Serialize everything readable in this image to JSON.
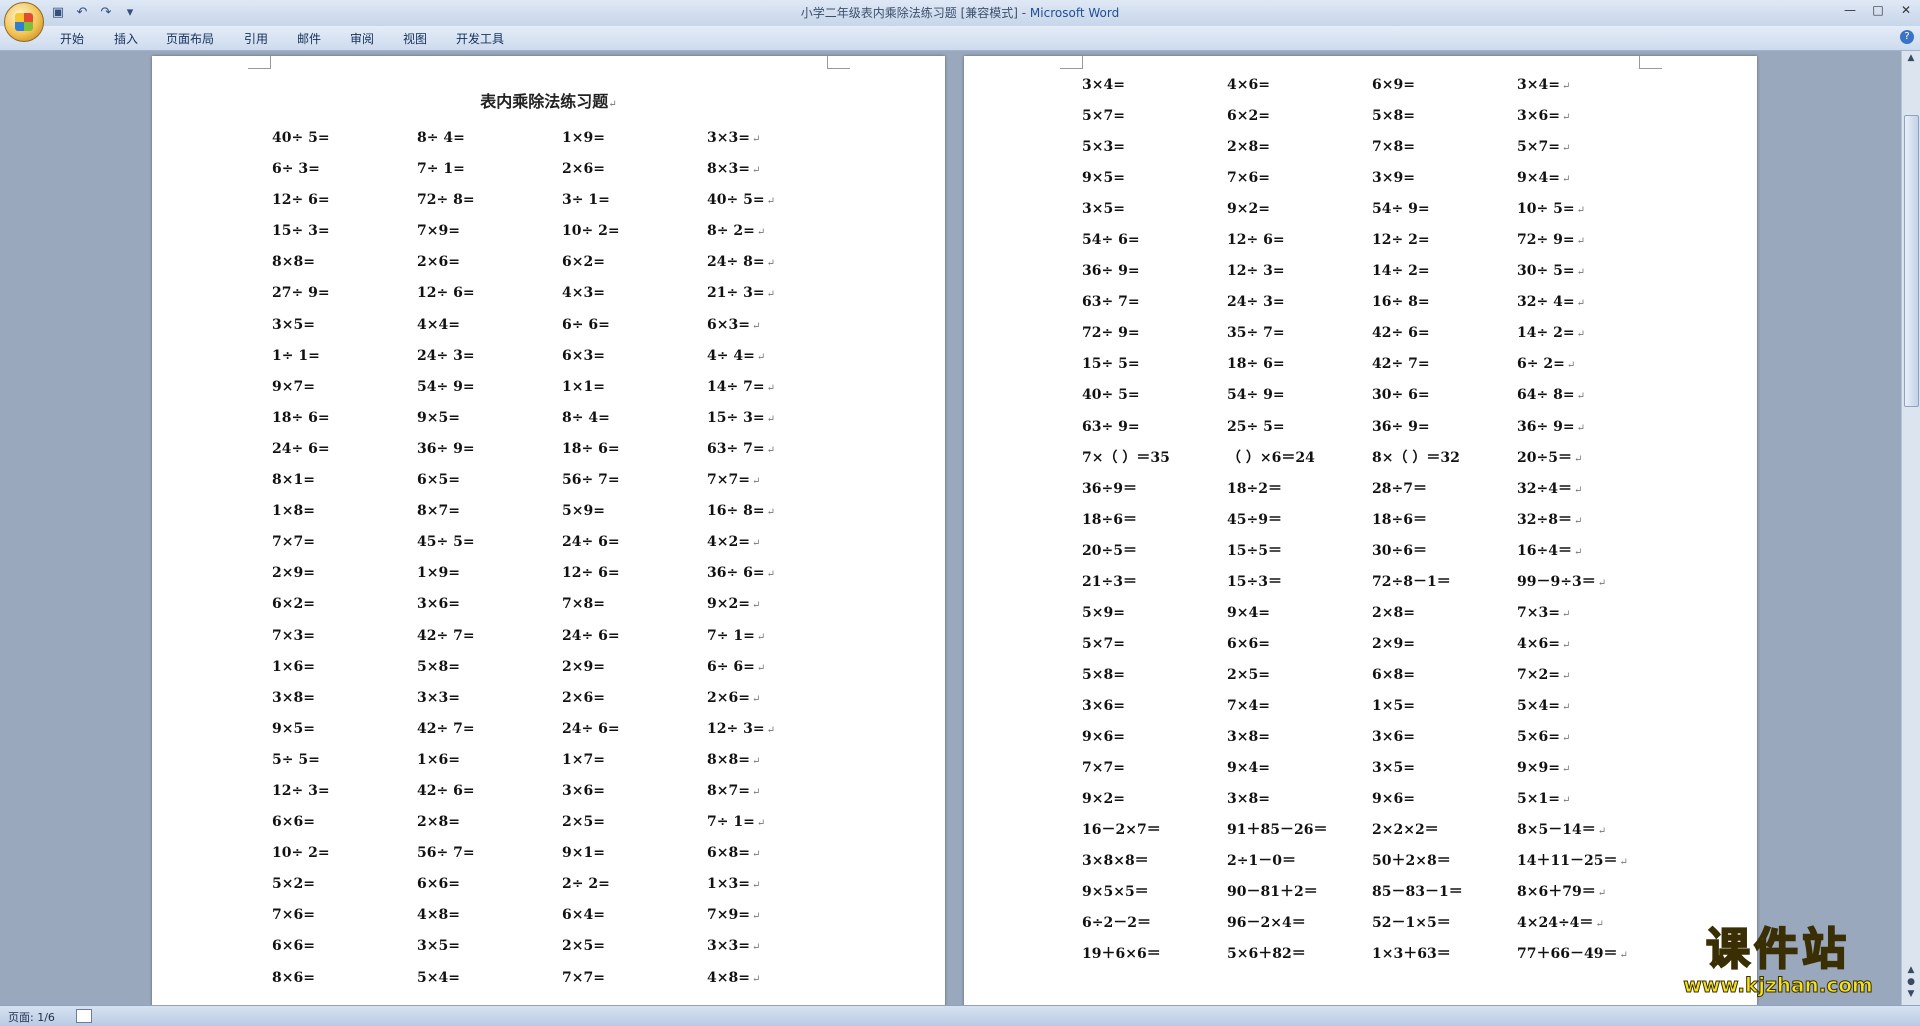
{
  "window": {
    "title_doc": "小学二年级表内乘除法练习题 [兼容模式] - ",
    "title_app": "Microsoft Word",
    "minimize": "—",
    "maximize": "□",
    "close": "✕"
  },
  "quick_access": [
    "save-icon",
    "undo-icon",
    "redo-icon",
    "customize-icon"
  ],
  "ribbon": {
    "tabs": [
      "开始",
      "插入",
      "页面布局",
      "引用",
      "邮件",
      "审阅",
      "视图",
      "开发工具"
    ]
  },
  "document": {
    "title": "表内乘除法练习题",
    "left_rows": [
      [
        "40÷ 5=",
        "8÷ 4=",
        "1×9=",
        "3×3="
      ],
      [
        "6÷ 3=",
        "7÷ 1=",
        "2×6=",
        "8×3="
      ],
      [
        "12÷ 6=",
        "72÷ 8=",
        "3÷ 1=",
        "40÷ 5="
      ],
      [
        "15÷ 3=",
        "7×9=",
        "10÷ 2=",
        "8÷ 2="
      ],
      [
        "8×8=",
        "2×6=",
        "6×2=",
        "24÷ 8="
      ],
      [
        "27÷ 9=",
        "12÷ 6=",
        "4×3=",
        "21÷ 3="
      ],
      [
        "3×5=",
        "4×4=",
        "6÷ 6=",
        "6×3="
      ],
      [
        "1÷ 1=",
        "24÷ 3=",
        "6×3=",
        "4÷ 4="
      ],
      [
        "9×7=",
        "54÷ 9=",
        "1×1=",
        "14÷ 7="
      ],
      [
        "18÷ 6=",
        "9×5=",
        "8÷ 4=",
        "15÷ 3="
      ],
      [
        "24÷ 6=",
        "36÷ 9=",
        "18÷ 6=",
        "63÷ 7="
      ],
      [
        "8×1=",
        "6×5=",
        "56÷ 7=",
        "7×7="
      ],
      [
        "1×8=",
        "8×7=",
        "5×9=",
        "16÷ 8="
      ],
      [
        "7×7=",
        "45÷ 5=",
        "24÷ 6=",
        "4×2="
      ],
      [
        "2×9=",
        "1×9=",
        "12÷ 6=",
        "36÷ 6="
      ],
      [
        "6×2=",
        "3×6=",
        "7×8=",
        "9×2="
      ],
      [
        "7×3=",
        "42÷ 7=",
        "24÷ 6=",
        "7÷ 1="
      ],
      [
        "1×6=",
        "5×8=",
        "2×9=",
        "6÷ 6="
      ],
      [
        "3×8=",
        "3×3=",
        "2×6=",
        "2×6="
      ],
      [
        "9×5=",
        "42÷ 7=",
        "24÷ 6=",
        "12÷ 3="
      ],
      [
        "5÷ 5=",
        "1×6=",
        "1×7=",
        "8×8="
      ],
      [
        "12÷ 3=",
        "42÷ 6=",
        "3×6=",
        "8×7="
      ],
      [
        "6×6=",
        "2×8=",
        "2×5=",
        "7÷ 1="
      ],
      [
        "10÷ 2=",
        "56÷ 7=",
        "9×1=",
        "6×8="
      ],
      [
        "5×2=",
        "6×6=",
        "2÷ 2=",
        "1×3="
      ],
      [
        "7×6=",
        "4×8=",
        "6×4=",
        "7×9="
      ],
      [
        "6×6=",
        "3×5=",
        "2×5=",
        "3×3="
      ],
      [
        "8×6=",
        "5×4=",
        "7×7=",
        "4×8="
      ]
    ],
    "right_rows": [
      [
        "3×4=",
        "4×6=",
        "6×9=",
        "3×4="
      ],
      [
        "5×7=",
        "6×2=",
        "5×8=",
        "3×6="
      ],
      [
        "5×3=",
        "2×8=",
        "7×8=",
        "5×7="
      ],
      [
        "9×5=",
        "7×6=",
        "3×9=",
        "9×4="
      ],
      [
        "3×5=",
        "9×2=",
        "54÷ 9=",
        "10÷ 5="
      ],
      [
        "54÷ 6=",
        "12÷ 6=",
        "12÷ 2=",
        "72÷ 9="
      ],
      [
        "36÷ 9=",
        "12÷ 3=",
        "14÷ 2=",
        "30÷ 5="
      ],
      [
        "63÷ 7=",
        "24÷ 3=",
        "16÷ 8=",
        "32÷ 4="
      ],
      [
        "72÷ 9=",
        "35÷ 7=",
        "42÷ 6=",
        "14÷ 2="
      ],
      [
        "15÷ 5=",
        "18÷ 6=",
        "42÷ 7=",
        "6÷ 2="
      ],
      [
        "40÷ 5=",
        "54÷ 9=",
        "30÷ 6=",
        "64÷ 8="
      ],
      [
        "63÷ 9=",
        "25÷ 5=",
        "36÷ 9=",
        "36÷ 9="
      ],
      [
        "7×（ ）＝35",
        "（ ）×6＝24",
        "8×（ ）＝32",
        "20÷5＝"
      ],
      [
        "36÷9＝",
        "18÷2＝",
        "28÷7＝",
        "32÷4＝"
      ],
      [
        "18÷6＝",
        "45÷9＝",
        "18÷6＝",
        "32÷8＝"
      ],
      [
        "20÷5＝",
        "15÷5＝",
        "30÷6＝",
        "16÷4＝"
      ],
      [
        "21÷3＝",
        "15÷3＝",
        "72÷8－1＝",
        "99－9÷3＝"
      ],
      [
        "5×9=",
        "9×4=",
        "2×8=",
        "7×3="
      ],
      [
        "5×7=",
        "6×6=",
        "2×9=",
        "4×6="
      ],
      [
        "5×8=",
        "2×5=",
        "6×8=",
        "7×2="
      ],
      [
        "3×6=",
        "7×4=",
        "1×5=",
        "5×4="
      ],
      [
        "9×6=",
        "3×8=",
        "3×6=",
        "5×6="
      ],
      [
        "7×7=",
        "9×4=",
        "3×5=",
        "9×9="
      ],
      [
        "9×2=",
        "3×8=",
        "9×6=",
        "5×1="
      ],
      [
        "16－2×7＝",
        "91＋85－26＝",
        "2×2×2＝",
        "8×5－14＝"
      ],
      [
        "3×8×8＝",
        "2÷1－0＝",
        "50＋2×8＝",
        "14＋11－25＝"
      ],
      [
        "9×5×5＝",
        "90－81＋2＝",
        "85－83－1＝",
        "8×6＋79＝"
      ],
      [
        "6÷2－2＝",
        "96－2×4＝",
        "52－1×5＝",
        "4×24÷4＝"
      ],
      [
        "19＋6×6＝",
        "5×6＋82＝",
        "1×3＋63＝",
        "77＋66－49＝"
      ]
    ],
    "paragraph_mark": "↵"
  },
  "status": {
    "page_info": "页面: 1/6"
  },
  "watermark": {
    "big": "课件站",
    "small": "www.kjzhan.com"
  }
}
